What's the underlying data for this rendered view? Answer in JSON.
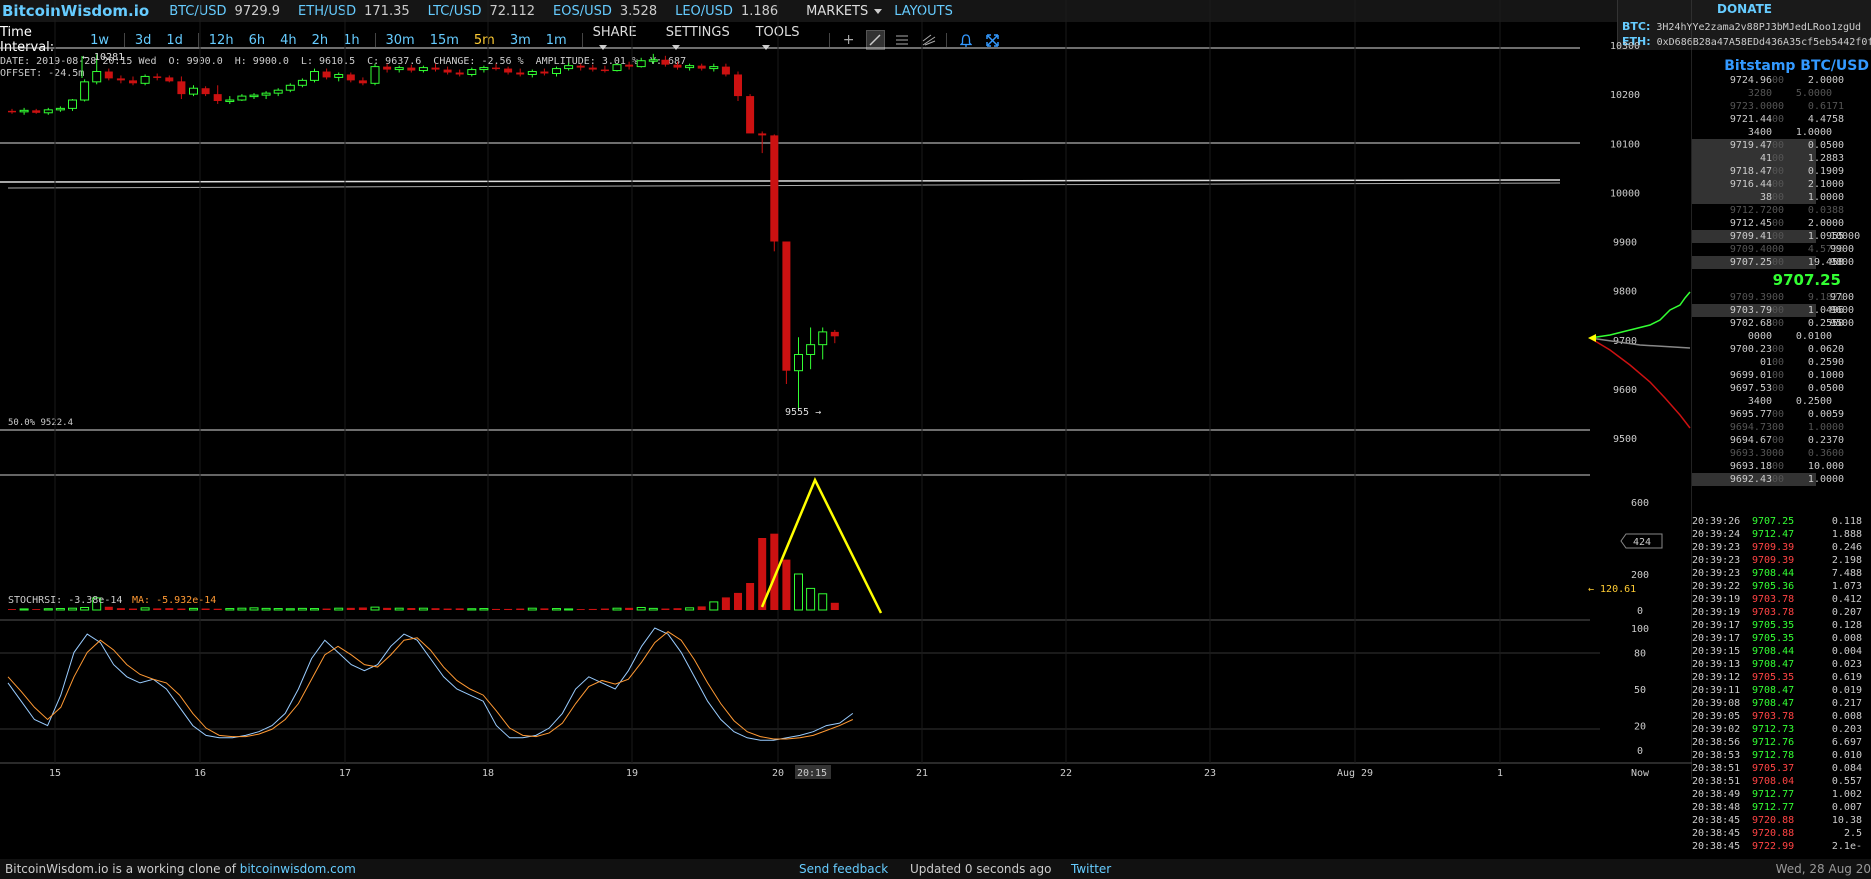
{
  "topbar": {
    "logo": "BitcoinWisdom.io",
    "tickers": [
      {
        "sym": "BTC/USD",
        "price": "9729.9"
      },
      {
        "sym": "ETH/USD",
        "price": "171.35"
      },
      {
        "sym": "LTC/USD",
        "price": "72.112"
      },
      {
        "sym": "EOS/USD",
        "price": "3.528"
      },
      {
        "sym": "LEO/USD",
        "price": "1.186"
      }
    ],
    "markets": "MARKETS",
    "layouts": "LAYOUTS"
  },
  "donate": {
    "title": "DONATE",
    "btc_label": "BTC:",
    "btc": "3H24hYYe2zama2v88PJ3bMJedLRoo1zgUd",
    "eth_label": "ETH:",
    "eth": "0xD686B28a47A58EDd436A35cf5eb5442f0f"
  },
  "toolbar": {
    "label": "Time Interval:",
    "intervals": [
      "1w",
      "3d",
      "1d",
      "12h",
      "6h",
      "4h",
      "2h",
      "1h",
      "30m",
      "15m",
      "5m",
      "3m",
      "1m"
    ],
    "active": "5m",
    "share": "SHARE",
    "settings": "SETTINGS",
    "tools": "TOOLS"
  },
  "info": {
    "line1": [
      "DATE: 2019-08-28 20:15 Wed",
      "O: 9900.0",
      "H: 9900.0",
      "L: 9610.5",
      "C: 9637.6",
      "CHANGE: -2.56 %",
      "AMPLITUDE: 3.01 %",
      "V: 687"
    ],
    "line2": "OFFSET: -24.5m"
  },
  "chart_data": {
    "type": "candlestick",
    "price_axis": [
      "10300",
      "10200",
      "10100",
      "10000",
      "9900",
      "9800",
      "9700",
      "9600",
      "9500"
    ],
    "price_range": [
      9500,
      10300
    ],
    "volume_axis": [
      "600",
      "400",
      "200",
      "0"
    ],
    "rsi_axis": [
      "100",
      "80",
      "50",
      "20",
      "0"
    ],
    "x_labels": [
      "15",
      "16",
      "17",
      "18",
      "19",
      "20",
      "20:15",
      "21",
      "22",
      "23",
      "Aug 29",
      "1",
      "Now"
    ],
    "annotations": {
      "high": "← 10281",
      "low": "9555 →",
      "fib": "50.0% 9522.4",
      "vol_current": "424",
      "vol_ma": "← 120.61"
    },
    "indicator": {
      "stochrsi": "STOCHRSI: -3.38e-14",
      "ma": "MA: -5.932e-14"
    },
    "candles": [
      [
        10166,
        10170,
        10160,
        10164
      ],
      [
        10164,
        10172,
        10158,
        10167
      ],
      [
        10167,
        10170,
        10160,
        10162
      ],
      [
        10162,
        10172,
        10158,
        10168
      ],
      [
        10168,
        10175,
        10164,
        10171
      ],
      [
        10171,
        10190,
        10166,
        10188
      ],
      [
        10188,
        10230,
        10185,
        10225
      ],
      [
        10225,
        10281,
        10220,
        10246
      ],
      [
        10246,
        10252,
        10228,
        10232
      ],
      [
        10232,
        10238,
        10222,
        10228
      ],
      [
        10228,
        10236,
        10218,
        10222
      ],
      [
        10222,
        10240,
        10218,
        10236
      ],
      [
        10236,
        10242,
        10228,
        10234
      ],
      [
        10234,
        10238,
        10224,
        10226
      ],
      [
        10226,
        10236,
        10190,
        10200
      ],
      [
        10200,
        10218,
        10196,
        10212
      ],
      [
        10212,
        10216,
        10196,
        10200
      ],
      [
        10200,
        10218,
        10180,
        10186
      ],
      [
        10186,
        10196,
        10180,
        10188
      ],
      [
        10188,
        10200,
        10186,
        10196
      ],
      [
        10196,
        10202,
        10190,
        10198
      ],
      [
        10198,
        10206,
        10190,
        10202
      ],
      [
        10202,
        10212,
        10196,
        10208
      ],
      [
        10208,
        10222,
        10204,
        10218
      ],
      [
        10218,
        10232,
        10214,
        10228
      ],
      [
        10228,
        10252,
        10224,
        10246
      ],
      [
        10246,
        10252,
        10230,
        10234
      ],
      [
        10234,
        10244,
        10226,
        10240
      ],
      [
        10240,
        10244,
        10224,
        10228
      ],
      [
        10228,
        10234,
        10218,
        10222
      ],
      [
        10222,
        10262,
        10218,
        10256
      ],
      [
        10256,
        10262,
        10244,
        10250
      ],
      [
        10250,
        10258,
        10244,
        10254
      ],
      [
        10254,
        10260,
        10244,
        10248
      ],
      [
        10248,
        10258,
        10244,
        10254
      ],
      [
        10254,
        10262,
        10246,
        10250
      ],
      [
        10250,
        10256,
        10240,
        10244
      ],
      [
        10244,
        10250,
        10236,
        10240
      ],
      [
        10240,
        10254,
        10236,
        10250
      ],
      [
        10250,
        10258,
        10244,
        10254
      ],
      [
        10254,
        10262,
        10248,
        10252
      ],
      [
        10252,
        10256,
        10240,
        10244
      ],
      [
        10244,
        10252,
        10236,
        10240
      ],
      [
        10240,
        10250,
        10234,
        10246
      ],
      [
        10246,
        10252,
        10238,
        10242
      ],
      [
        10242,
        10256,
        10236,
        10252
      ],
      [
        10252,
        10264,
        10248,
        10258
      ],
      [
        10258,
        10262,
        10248,
        10254
      ],
      [
        10254,
        10260,
        10246,
        10250
      ],
      [
        10250,
        10258,
        10244,
        10248
      ],
      [
        10248,
        10262,
        10246,
        10260
      ],
      [
        10260,
        10266,
        10250,
        10256
      ],
      [
        10256,
        10274,
        10254,
        10268
      ],
      [
        10268,
        10282,
        10262,
        10270
      ],
      [
        10270,
        10278,
        10256,
        10260
      ],
      [
        10260,
        10266,
        10250,
        10254
      ],
      [
        10254,
        10262,
        10248,
        10258
      ],
      [
        10258,
        10262,
        10248,
        10252
      ],
      [
        10252,
        10262,
        10246,
        10256
      ],
      [
        10256,
        10262,
        10236,
        10240
      ],
      [
        10240,
        10246,
        10186,
        10196
      ],
      [
        10196,
        10200,
        10140,
        10120
      ],
      [
        10120,
        10124,
        10080,
        10116
      ],
      [
        10116,
        10118,
        9880,
        9900
      ],
      [
        9900,
        9900,
        9610,
        9637
      ],
      [
        9637,
        9705,
        9555,
        9670
      ],
      [
        9670,
        9725,
        9640,
        9690
      ],
      [
        9690,
        9725,
        9660,
        9716
      ],
      [
        9716,
        9720,
        9693,
        9707
      ]
    ],
    "volumes": [
      5,
      6,
      5,
      7,
      8,
      10,
      14,
      67,
      18,
      10,
      8,
      12,
      9,
      10,
      8,
      9,
      8,
      7,
      8,
      10,
      12,
      9,
      8,
      7,
      9,
      8,
      8,
      10,
      12,
      14,
      16,
      12,
      10,
      11,
      10,
      10,
      8,
      9,
      7,
      8,
      6,
      6,
      8,
      10,
      9,
      8,
      6,
      5,
      6,
      8,
      10,
      12,
      14,
      9,
      8,
      10,
      12,
      20,
      45,
      70,
      95,
      150,
      400,
      424,
      280,
      200,
      120,
      90,
      40
    ],
    "stoch": [
      55,
      40,
      25,
      20,
      45,
      80,
      95,
      88,
      70,
      60,
      55,
      58,
      50,
      35,
      20,
      12,
      10,
      10,
      12,
      15,
      20,
      30,
      50,
      75,
      90,
      80,
      70,
      65,
      70,
      85,
      95,
      90,
      75,
      60,
      50,
      45,
      40,
      20,
      10,
      10,
      12,
      18,
      30,
      50,
      60,
      55,
      50,
      65,
      85,
      100,
      95,
      80,
      60,
      40,
      25,
      15,
      10,
      8,
      8,
      10,
      12,
      15,
      20,
      22,
      30
    ],
    "stochma": [
      60,
      48,
      35,
      25,
      35,
      60,
      80,
      90,
      82,
      70,
      62,
      58,
      55,
      45,
      30,
      18,
      12,
      11,
      11,
      13,
      17,
      25,
      38,
      58,
      78,
      85,
      78,
      70,
      68,
      78,
      90,
      92,
      82,
      68,
      57,
      50,
      45,
      32,
      18,
      12,
      11,
      14,
      22,
      38,
      52,
      57,
      54,
      58,
      72,
      88,
      97,
      90,
      74,
      55,
      38,
      24,
      15,
      11,
      9,
      9,
      10,
      12,
      16,
      20,
      25
    ]
  },
  "orderbook": {
    "title": "Bitstamp BTC/USD",
    "asks": [
      {
        "p": "9724.96",
        "pd": "00",
        "a": "2.0000",
        "dim": false,
        "hl": false
      },
      {
        "p": "3280",
        "pd": "",
        "a": "5.0000",
        "dim": true,
        "hl": false
      },
      {
        "p": "9723.00",
        "pd": "00",
        "a": "0.6171",
        "dim": true,
        "hl": false
      },
      {
        "p": "9721.44",
        "pd": "00",
        "a": "4.4758",
        "dim": false,
        "hl": false
      },
      {
        "p": "3400",
        "pd": "",
        "a": "1.0000",
        "dim": false,
        "hl": false
      },
      {
        "p": "9719.47",
        "pd": "00",
        "a": "0.0500",
        "dim": false,
        "hl": true
      },
      {
        "p": "41",
        "pd": "00",
        "a": "1.2883",
        "dim": false,
        "hl": true
      },
      {
        "p": "9718.47",
        "pd": "00",
        "a": "0.1909",
        "dim": false,
        "hl": true
      },
      {
        "p": "9716.44",
        "pd": "00",
        "a": "2.1000",
        "dim": false,
        "hl": true
      },
      {
        "p": "38",
        "pd": "00",
        "a": "1.0000",
        "dim": false,
        "hl": true
      },
      {
        "p": "9712.72",
        "pd": "00",
        "a": "0.0388",
        "dim": true,
        "hl": false
      },
      {
        "p": "9712.45",
        "pd": "00",
        "a": "2.0000",
        "dim": false,
        "hl": false
      },
      {
        "p": "9709.41",
        "pd": "00",
        "a": "1.0955",
        "dim": false,
        "hl": true,
        "s": "10000"
      },
      {
        "p": "9709.40",
        "pd": "00",
        "a": "4.5736",
        "dim": true,
        "hl": false,
        "s": "9900"
      },
      {
        "p": "9707.25",
        "pd": "00",
        "a": "19.458",
        "dim": false,
        "hl": true,
        "s": "9800"
      }
    ],
    "mid": "9707.25",
    "bids": [
      {
        "p": "9709.39",
        "pd": "00",
        "a": "9.1821",
        "dim": true,
        "hl": false,
        "s": "9700"
      },
      {
        "p": "9703.79",
        "pd": "00",
        "a": "1.0496",
        "dim": false,
        "hl": true,
        "s": "9600"
      },
      {
        "p": "9702.68",
        "pd": "00",
        "a": "0.2550",
        "dim": false,
        "hl": false,
        "s": "9500"
      },
      {
        "p": "0000",
        "pd": "",
        "a": "0.0100",
        "dim": false,
        "hl": false
      },
      {
        "p": "9700.23",
        "pd": "00",
        "a": "0.0620",
        "dim": false,
        "hl": false
      },
      {
        "p": "01",
        "pd": "00",
        "a": "0.2590",
        "dim": false,
        "hl": false
      },
      {
        "p": "9699.01",
        "pd": "00",
        "a": "0.1000",
        "dim": false,
        "hl": false
      },
      {
        "p": "9697.53",
        "pd": "00",
        "a": "0.0500",
        "dim": false,
        "hl": false
      },
      {
        "p": "3400",
        "pd": "",
        "a": "0.2500",
        "dim": false,
        "hl": false
      },
      {
        "p": "9695.77",
        "pd": "00",
        "a": "0.0059",
        "dim": false,
        "hl": false
      },
      {
        "p": "9694.73",
        "pd": "00",
        "a": "1.0000",
        "dim": true,
        "hl": false
      },
      {
        "p": "9694.67",
        "pd": "00",
        "a": "0.2370",
        "dim": false,
        "hl": false
      },
      {
        "p": "9693.30",
        "pd": "00",
        "a": "0.3600",
        "dim": true,
        "hl": false
      },
      {
        "p": "9693.18",
        "pd": "00",
        "a": "10.000",
        "dim": false,
        "hl": false
      },
      {
        "p": "9692.43",
        "pd": "00",
        "a": "1.0000",
        "dim": false,
        "hl": true
      }
    ]
  },
  "trades": [
    {
      "t": "20:39:26",
      "p": "9707.25",
      "d": "up",
      "a": "0.118"
    },
    {
      "t": "20:39:24",
      "p": "9712.47",
      "d": "up",
      "a": "1.888"
    },
    {
      "t": "20:39:23",
      "p": "9709.39",
      "d": "dn",
      "a": "0.246"
    },
    {
      "t": "20:39:23",
      "p": "9709.39",
      "d": "dn",
      "a": "2.198"
    },
    {
      "t": "20:39:23",
      "p": "9708.44",
      "d": "up",
      "a": "7.488"
    },
    {
      "t": "20:39:22",
      "p": "9705.36",
      "d": "up",
      "a": "1.073"
    },
    {
      "t": "20:39:19",
      "p": "9703.78",
      "d": "dn",
      "a": "0.412"
    },
    {
      "t": "20:39:19",
      "p": "9703.78",
      "d": "dn",
      "a": "0.207"
    },
    {
      "t": "20:39:17",
      "p": "9705.35",
      "d": "up",
      "a": "0.128"
    },
    {
      "t": "20:39:17",
      "p": "9705.35",
      "d": "up",
      "a": "0.008"
    },
    {
      "t": "20:39:15",
      "p": "9708.44",
      "d": "up",
      "a": "0.004"
    },
    {
      "t": "20:39:13",
      "p": "9708.47",
      "d": "up",
      "a": "0.023"
    },
    {
      "t": "20:39:12",
      "p": "9705.35",
      "d": "dn",
      "a": "0.619"
    },
    {
      "t": "20:39:11",
      "p": "9708.47",
      "d": "up",
      "a": "0.019"
    },
    {
      "t": "20:39:08",
      "p": "9708.47",
      "d": "up",
      "a": "0.217"
    },
    {
      "t": "20:39:05",
      "p": "9703.78",
      "d": "dn",
      "a": "0.008"
    },
    {
      "t": "20:39:02",
      "p": "9712.73",
      "d": "up",
      "a": "0.203"
    },
    {
      "t": "20:38:56",
      "p": "9712.76",
      "d": "up",
      "a": "6.697"
    },
    {
      "t": "20:38:53",
      "p": "9712.78",
      "d": "up",
      "a": "0.010"
    },
    {
      "t": "20:38:51",
      "p": "9705.37",
      "d": "dn",
      "a": "0.084"
    },
    {
      "t": "20:38:51",
      "p": "9708.04",
      "d": "dn",
      "a": "0.557"
    },
    {
      "t": "20:38:49",
      "p": "9712.77",
      "d": "up",
      "a": "1.002"
    },
    {
      "t": "20:38:48",
      "p": "9712.77",
      "d": "up",
      "a": "0.007"
    },
    {
      "t": "20:38:45",
      "p": "9720.88",
      "d": "dn",
      "a": "10.38"
    },
    {
      "t": "20:38:45",
      "p": "9720.88",
      "d": "dn",
      "a": "2.5"
    },
    {
      "t": "20:38:45",
      "p": "9722.99",
      "d": "dn",
      "a": "2.1e-"
    }
  ],
  "footer": {
    "note": "BitcoinWisdom.io is a working clone of ",
    "link": "bitcoinwisdom.com",
    "feedback": "Send feedback",
    "updated": "Updated 0 seconds ago",
    "twitter": "Twitter",
    "date": "Wed, 28 Aug 20"
  },
  "colors": {
    "up": "#33ff33",
    "down": "#cc1111",
    "accent": "#66ccff",
    "active": "#ffcc33",
    "trendline": "#ffff00"
  }
}
